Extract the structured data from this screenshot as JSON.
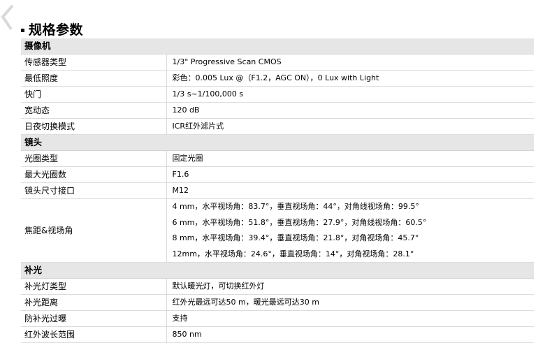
{
  "section_title": "规格参数",
  "groups": [
    {
      "title": "摄像机",
      "rows": [
        {
          "label": "传感器类型",
          "value": "1/3\" Progressive Scan CMOS"
        },
        {
          "label": "最低照度",
          "value": "彩色：0.005 Lux @（F1.2，AGC ON），0 Lux with Light"
        },
        {
          "label": "快门",
          "value": "1/3 s~1/100,000 s"
        },
        {
          "label": "宽动态",
          "value": "120 dB"
        },
        {
          "label": "日夜切换模式",
          "value": "ICR红外滤片式"
        }
      ]
    },
    {
      "title": "镜头",
      "rows": [
        {
          "label": "光圈类型",
          "value": "固定光圈"
        },
        {
          "label": "最大光圈数",
          "value": "F1.6"
        },
        {
          "label": "镜头尺寸接口",
          "value": "M12"
        }
      ],
      "multi_row": {
        "label": "焦距&视场角",
        "lines": [
          "4 mm，水平视场角：83.7°，垂直视场角：44°，对角线视场角：99.5°",
          "6 mm，水平视场角：51.8°，垂直视场角：27.9°，对角线视场角：60.5°",
          "8 mm，水平视场角：39.4°，垂直视场角：21.8°，对角视场角：45.7°",
          "12mm，水平视场角：24.6°，垂直视场角：14°，对角视场角：28.1°"
        ]
      }
    },
    {
      "title": "补光",
      "rows": [
        {
          "label": "补光灯类型",
          "value": "默认暖光灯，可切换红外灯"
        },
        {
          "label": "补光距离",
          "value": "红外光最远可达50 m，暖光最远可达30 m"
        },
        {
          "label": "防补光过曝",
          "value": "支持"
        },
        {
          "label": "红外波长范围",
          "value": "850 nm"
        }
      ]
    }
  ]
}
